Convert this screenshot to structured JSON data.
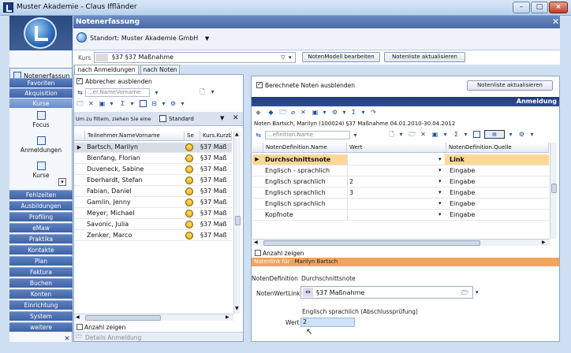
{
  "window": {
    "title": "Muster Akademie - Claus Iffländer"
  },
  "module": {
    "title": "Notenerfassung"
  },
  "sidebar": {
    "current": "Notenerfassun",
    "items": [
      "Favoriten",
      "Akquisition",
      "Kurse"
    ],
    "sub_items": [
      "Focus",
      "Anmeldungen",
      "Kurse"
    ],
    "lower_items": [
      "Fehlzeiten",
      "Ausbildungen",
      "Profiling",
      "eMaw",
      "Praktika",
      "Kontakte",
      "Plan",
      "Faktura",
      "Buchen",
      "Konten",
      "Einrichtung",
      "System",
      "weitere"
    ],
    "close": "×"
  },
  "header": {
    "standort": "Standort: Muster Akademie GmbH"
  },
  "kurs": {
    "label": "Kurs",
    "value": "§37 §37 Maßnahme",
    "btn_notenmodell": "NotenModell bearbeiten",
    "btn_notenliste": "Notenliste aktualisieren"
  },
  "tabs": [
    "nach Anmeldungen",
    "nach Noten"
  ],
  "participants": {
    "abbrecher_label": "Abbrecher ausblenden",
    "filter_placeholder": "...er.NameVorname",
    "groupbar_hint": "Um zu filtern, ziehen Sie eine",
    "groupbar_standard": "Standard",
    "columns": [
      "Teilnehmer.NameVorname",
      "Se",
      "Kurs.Kurzb"
    ],
    "rows": [
      {
        "name": "Bartsch, Marilyn",
        "kurs": "§37 Maß"
      },
      {
        "name": "Bienfang, Florian",
        "kurs": "§37 Maß"
      },
      {
        "name": "Duveneck, Sabine",
        "kurs": "§37 Maß"
      },
      {
        "name": "Eberhardt, Stefan",
        "kurs": "§37 Maß"
      },
      {
        "name": "Fabian, Daniel",
        "kurs": "§37 Maß"
      },
      {
        "name": "Gamlin, Jenny",
        "kurs": "§37 Maß"
      },
      {
        "name": "Meyer, Michael",
        "kurs": "§37 Maß"
      },
      {
        "name": "Savonic, Julia",
        "kurs": "§37 Maß"
      },
      {
        "name": "Zenker, Marco",
        "kurs": "§37 Maß"
      }
    ],
    "anzahl_label": "Anzahl zeigen",
    "details_label": "Details Anmeldung"
  },
  "grades": {
    "berechnete_label": "Berechnete Noten ausblenden",
    "btn_notenliste": "Notenliste aktualisieren",
    "band_title": "Anmeldung",
    "subtitle": "Noten Bartsch, Marilyn (100024)  §37 Maßnahme  04.01.2010-30.04.2012",
    "filter_placeholder": "...efinition.Name",
    "columns": [
      "NotenDefinition.Name",
      "Wert",
      "NotenDefinition.Quelle"
    ],
    "rows": [
      {
        "name": "Durchschnittsnote",
        "wert": "",
        "quelle": "Link"
      },
      {
        "name": "Englisch - sprachlich",
        "wert": "",
        "quelle": "Eingabe"
      },
      {
        "name": "Englisch sprachlich",
        "wert": "2",
        "quelle": "Eingabe"
      },
      {
        "name": "Englisch sprachlich",
        "wert": "3",
        "quelle": "Eingabe"
      },
      {
        "name": "Englisch sprachlich",
        "wert": "",
        "quelle": "Eingabe"
      },
      {
        "name": "Kopfnote",
        "wert": "",
        "quelle": "Eingabe"
      }
    ],
    "anzahl_label": "Anzahl zeigen",
    "notenlink_label": "Notenlink für",
    "notenlink_name": "Marilyn Bartsch",
    "notendef_label": "NotenDefinition",
    "notendef_value": "Durchschnittsnote",
    "notenwertlink_label": "NotenWertLink",
    "notenwertlink_value": "§37 Maßnahme",
    "englisch_caption": "Englisch sprachlich (Abschlussprüfung)",
    "wert_label": "Wert",
    "wert_value": "2"
  }
}
